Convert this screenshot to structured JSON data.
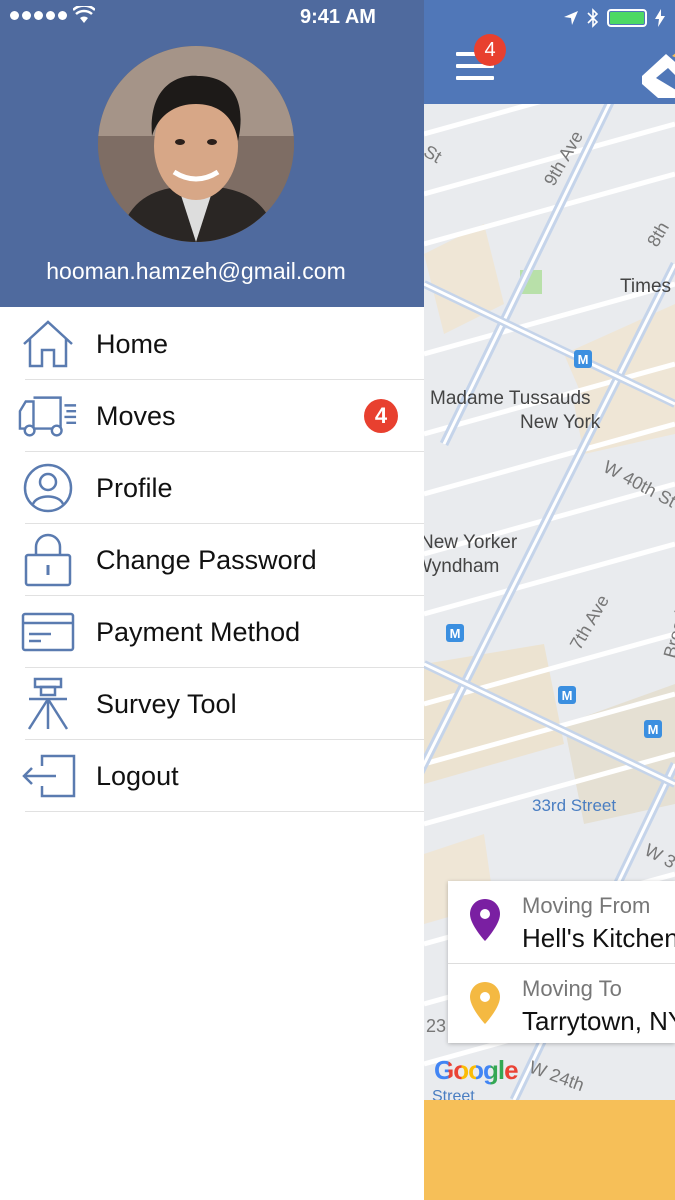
{
  "status_bar": {
    "time": "9:41 AM"
  },
  "drawer": {
    "email": "hooman.hamzeh@gmail.com",
    "menu": [
      {
        "label": "Home",
        "icon": "home-icon"
      },
      {
        "label": "Moves",
        "icon": "truck-icon",
        "badge": "4"
      },
      {
        "label": "Profile",
        "icon": "user-circle-icon"
      },
      {
        "label": "Change Password",
        "icon": "lock-icon"
      },
      {
        "label": "Payment Method",
        "icon": "credit-card-icon"
      },
      {
        "label": "Survey Tool",
        "icon": "survey-tripod-icon"
      },
      {
        "label": "Logout",
        "icon": "logout-icon"
      }
    ]
  },
  "main": {
    "notification_badge": "4",
    "map_labels": {
      "st": "St",
      "ninth_ave": "9th Ave",
      "eighth": "8th",
      "times": "Times",
      "tussauds_1": "Madame Tussauds",
      "tussauds_2": "New York",
      "w40": "W 40th St",
      "newyorker_1": "New Yorker",
      "newyorker_2": "Wyndham",
      "seventh_ave": "7th Ave",
      "broad": "Broad",
      "street33": "33rd Street",
      "w3": "W 3",
      "n23": "23",
      "w24": "W 24th",
      "street_bottom": "Street",
      "google": "Google"
    },
    "moving_from": {
      "caption": "Moving From",
      "value": "Hell's Kitchen"
    },
    "moving_to": {
      "caption": "Moving To",
      "value": "Tarrytown, NY"
    }
  },
  "colors": {
    "drawer_header": "#4f6a9e",
    "app_bar": "#5077b8",
    "badge": "#e8402f",
    "bottom_bar": "#f6bf58",
    "icon_stroke": "#5a7bb0"
  }
}
